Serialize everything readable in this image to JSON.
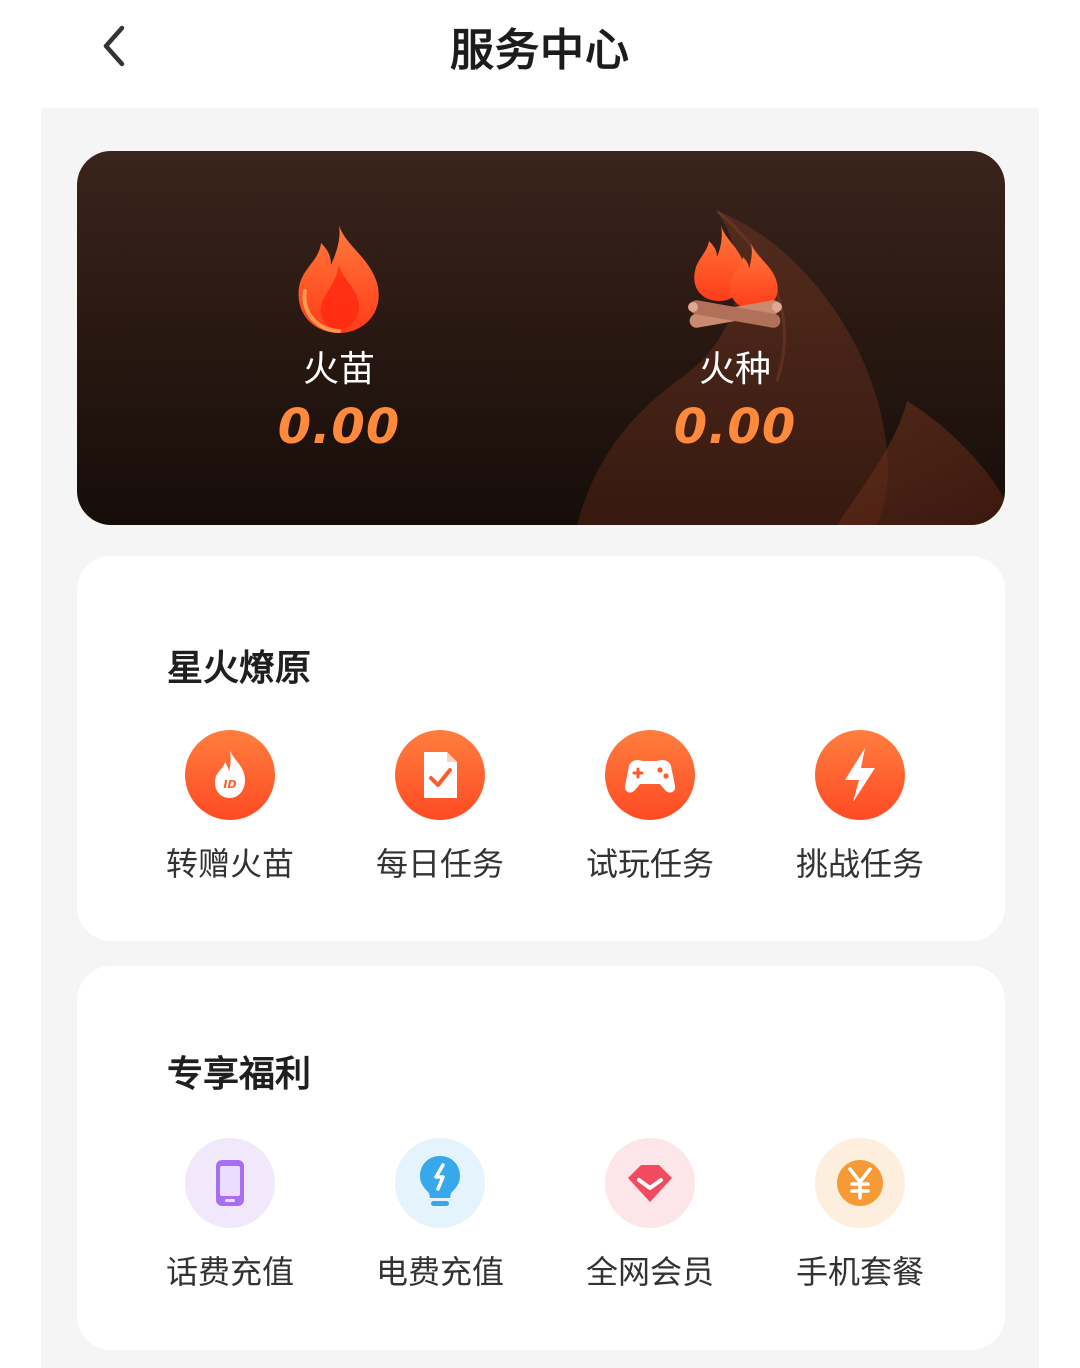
{
  "header": {
    "title": "服务中心",
    "back_icon": "chevron-left-icon"
  },
  "balances": [
    {
      "label": "火苗",
      "value": "0.00",
      "icon": "flame-icon"
    },
    {
      "label": "火种",
      "value": "0.00",
      "icon": "campfire-icon"
    }
  ],
  "sections": [
    {
      "title": "星火燎原",
      "items": [
        {
          "label": "转赠火苗",
          "icon": "gift-flame-icon"
        },
        {
          "label": "每日任务",
          "icon": "daily-task-icon"
        },
        {
          "label": "试玩任务",
          "icon": "gamepad-icon"
        },
        {
          "label": "挑战任务",
          "icon": "lightning-icon"
        }
      ]
    },
    {
      "title": "专享福利",
      "items": [
        {
          "label": "话费充值",
          "icon": "phone-icon"
        },
        {
          "label": "电费充值",
          "icon": "lightbulb-icon"
        },
        {
          "label": "全网会员",
          "icon": "diamond-icon"
        },
        {
          "label": "手机套餐",
          "icon": "yen-coin-icon"
        }
      ]
    }
  ],
  "colors": {
    "accent": "#ff5a2a",
    "value_orange": "#ff8a3c",
    "banner_dark": "#2a1912",
    "background": "#f5f5f5"
  }
}
